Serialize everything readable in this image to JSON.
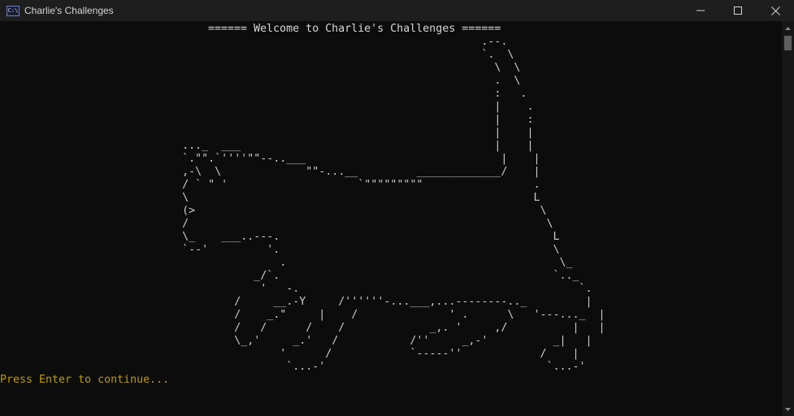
{
  "window": {
    "title": "Charlie's Challenges",
    "icon": "console-app-icon",
    "icon_glyph": "C:\\"
  },
  "controls": [
    "minimize-icon",
    "maximize-icon",
    "close-icon"
  ],
  "console": {
    "banner": "====== Welcome to Charlie's Challenges ======",
    "ascii_art": "                                                                          .--.\n                                                                          `.  \\\n                                                                            \\  \\\n                                                                            .  \\\n                                                                            :   .\n                                                                            |    .\n                                                                            |    :\n                                                                            |    |\n                            ..._  ___                                       |    |\n                            `.\"\".`''''\"\"--..___                              |    |\n                            ,-\\  \\             \"\"-...__         _____________/    |\n                            / ` \" '                    `\"\"\"\"\"\"\"\"\"                 .\n                            \\                                                     L\n                            (>                                                     \\\n                            /                                                       \\\n                            \\_    ___..---.                                          L\n                            `--'         '.                                          \\\n                                           .                                          \\_\n                                       _/`.                                          `.._\n                                        '   -.                                           `.\n                                    /     __.-Y     /''''''-...___,...--------.._         |\n                                    /    _.\"     |    /              ' .      \\   '---..._  |\n                                    /   /      /    /             _,. '     ,/          |   |\n                                    \\_,'     _.'   /           /''     _,-'          _|   |\n                                           '      /            `-----''            /    |\n                                            `...-'                                  `...-'",
    "prompt": "Press Enter to continue..."
  },
  "colors": {
    "background": "#0c0c0c",
    "titlebar": "#1e1e1e",
    "text": "#cccccc",
    "prompt": "#c19c00"
  }
}
